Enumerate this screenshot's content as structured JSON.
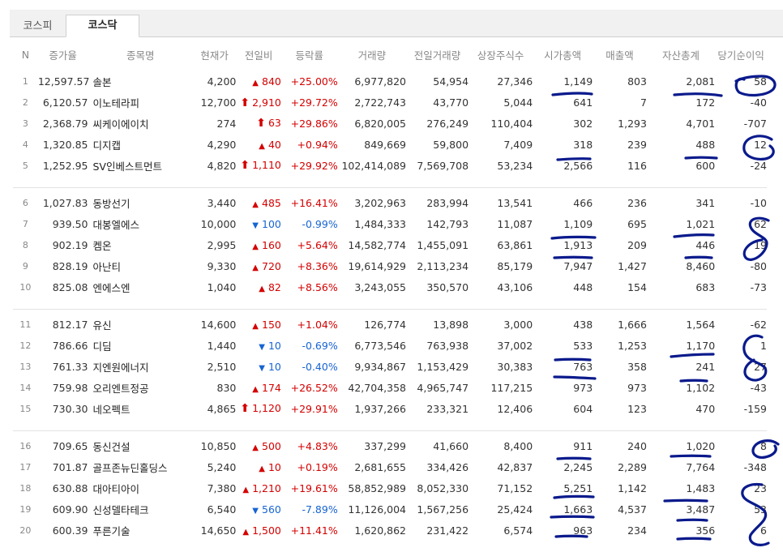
{
  "tabs": [
    {
      "label": "코스피",
      "active": false
    },
    {
      "label": "코스닥",
      "active": true
    }
  ],
  "columns": [
    "N",
    "증가율",
    "종목명",
    "현재가",
    "전일비",
    "등락률",
    "거래량",
    "전일거래량",
    "상장주식수",
    "시가총액",
    "매출액",
    "자산총계",
    "당기순이익"
  ],
  "colors": {
    "up": "#d40000",
    "down": "#1764d3",
    "pen": "#0a1a8c"
  },
  "groups": [
    [
      {
        "n": "1",
        "rate_inc": "12,597.57",
        "name": "솔본",
        "price": "4,200",
        "dir": "up",
        "arrow": "▲",
        "change": "840",
        "pct": "+25.00%",
        "volume": "6,977,820",
        "prev_volume": "54,954",
        "shares": "27,346",
        "mcap": "1,149",
        "sales": "803",
        "assets": "2,081",
        "net_income": "58"
      },
      {
        "n": "2",
        "rate_inc": "6,120.57",
        "name": "이노테라피",
        "price": "12,700",
        "dir": "up",
        "arrow": "⬆",
        "change": "2,910",
        "pct": "+29.72%",
        "volume": "2,722,743",
        "prev_volume": "43,770",
        "shares": "5,044",
        "mcap": "641",
        "sales": "7",
        "assets": "172",
        "net_income": "-40"
      },
      {
        "n": "3",
        "rate_inc": "2,368.79",
        "name": "씨케이에이치",
        "price": "274",
        "dir": "up",
        "arrow": "⬆",
        "change": "63",
        "pct": "+29.86%",
        "volume": "6,820,005",
        "prev_volume": "276,249",
        "shares": "110,404",
        "mcap": "302",
        "sales": "1,293",
        "assets": "4,701",
        "net_income": "-707"
      },
      {
        "n": "4",
        "rate_inc": "1,320.85",
        "name": "디지캡",
        "price": "4,290",
        "dir": "up",
        "arrow": "▲",
        "change": "40",
        "pct": "+0.94%",
        "volume": "849,669",
        "prev_volume": "59,800",
        "shares": "7,409",
        "mcap": "318",
        "sales": "239",
        "assets": "488",
        "net_income": "12"
      },
      {
        "n": "5",
        "rate_inc": "1,252.95",
        "name": "SV인베스트먼트",
        "price": "4,820",
        "dir": "up",
        "arrow": "⬆",
        "change": "1,110",
        "pct": "+29.92%",
        "volume": "102,414,089",
        "prev_volume": "7,569,708",
        "shares": "53,234",
        "mcap": "2,566",
        "sales": "116",
        "assets": "600",
        "net_income": "-24"
      }
    ],
    [
      {
        "n": "6",
        "rate_inc": "1,027.83",
        "name": "동방선기",
        "price": "3,440",
        "dir": "up",
        "arrow": "▲",
        "change": "485",
        "pct": "+16.41%",
        "volume": "3,202,963",
        "prev_volume": "283,994",
        "shares": "13,541",
        "mcap": "466",
        "sales": "236",
        "assets": "341",
        "net_income": "-10"
      },
      {
        "n": "7",
        "rate_inc": "939.50",
        "name": "대봉엘에스",
        "price": "10,000",
        "dir": "down",
        "arrow": "▼",
        "change": "100",
        "pct": "-0.99%",
        "volume": "1,484,333",
        "prev_volume": "142,793",
        "shares": "11,087",
        "mcap": "1,109",
        "sales": "695",
        "assets": "1,021",
        "net_income": "62"
      },
      {
        "n": "8",
        "rate_inc": "902.19",
        "name": "켐온",
        "price": "2,995",
        "dir": "up",
        "arrow": "▲",
        "change": "160",
        "pct": "+5.64%",
        "volume": "14,582,774",
        "prev_volume": "1,455,091",
        "shares": "63,861",
        "mcap": "1,913",
        "sales": "209",
        "assets": "446",
        "net_income": "19"
      },
      {
        "n": "9",
        "rate_inc": "828.19",
        "name": "아난티",
        "price": "9,330",
        "dir": "up",
        "arrow": "▲",
        "change": "720",
        "pct": "+8.36%",
        "volume": "19,614,929",
        "prev_volume": "2,113,234",
        "shares": "85,179",
        "mcap": "7,947",
        "sales": "1,427",
        "assets": "8,460",
        "net_income": "-80"
      },
      {
        "n": "10",
        "rate_inc": "825.08",
        "name": "엔에스엔",
        "price": "1,040",
        "dir": "up",
        "arrow": "▲",
        "change": "82",
        "pct": "+8.56%",
        "volume": "3,243,055",
        "prev_volume": "350,570",
        "shares": "43,106",
        "mcap": "448",
        "sales": "154",
        "assets": "683",
        "net_income": "-73"
      }
    ],
    [
      {
        "n": "11",
        "rate_inc": "812.17",
        "name": "유신",
        "price": "14,600",
        "dir": "up",
        "arrow": "▲",
        "change": "150",
        "pct": "+1.04%",
        "volume": "126,774",
        "prev_volume": "13,898",
        "shares": "3,000",
        "mcap": "438",
        "sales": "1,666",
        "assets": "1,564",
        "net_income": "-62"
      },
      {
        "n": "12",
        "rate_inc": "786.66",
        "name": "디딤",
        "price": "1,440",
        "dir": "down",
        "arrow": "▼",
        "change": "10",
        "pct": "-0.69%",
        "volume": "6,773,546",
        "prev_volume": "763,938",
        "shares": "37,002",
        "mcap": "533",
        "sales": "1,253",
        "assets": "1,170",
        "net_income": "1"
      },
      {
        "n": "13",
        "rate_inc": "761.33",
        "name": "지엔원에너지",
        "price": "2,510",
        "dir": "down",
        "arrow": "▼",
        "change": "10",
        "pct": "-0.40%",
        "volume": "9,934,867",
        "prev_volume": "1,153,429",
        "shares": "30,383",
        "mcap": "763",
        "sales": "358",
        "assets": "241",
        "net_income": "27"
      },
      {
        "n": "14",
        "rate_inc": "759.98",
        "name": "오리엔트정공",
        "price": "830",
        "dir": "up",
        "arrow": "▲",
        "change": "174",
        "pct": "+26.52%",
        "volume": "42,704,358",
        "prev_volume": "4,965,747",
        "shares": "117,215",
        "mcap": "973",
        "sales": "973",
        "assets": "1,102",
        "net_income": "-43"
      },
      {
        "n": "15",
        "rate_inc": "730.30",
        "name": "네오펙트",
        "price": "4,865",
        "dir": "up",
        "arrow": "⬆",
        "change": "1,120",
        "pct": "+29.91%",
        "volume": "1,937,266",
        "prev_volume": "233,321",
        "shares": "12,406",
        "mcap": "604",
        "sales": "123",
        "assets": "470",
        "net_income": "-159"
      }
    ],
    [
      {
        "n": "16",
        "rate_inc": "709.65",
        "name": "동신건설",
        "price": "10,850",
        "dir": "up",
        "arrow": "▲",
        "change": "500",
        "pct": "+4.83%",
        "volume": "337,299",
        "prev_volume": "41,660",
        "shares": "8,400",
        "mcap": "911",
        "sales": "240",
        "assets": "1,020",
        "net_income": "8"
      },
      {
        "n": "17",
        "rate_inc": "701.87",
        "name": "골프존뉴딘홀딩스",
        "price": "5,240",
        "dir": "up",
        "arrow": "▲",
        "change": "10",
        "pct": "+0.19%",
        "volume": "2,681,655",
        "prev_volume": "334,426",
        "shares": "42,837",
        "mcap": "2,245",
        "sales": "2,289",
        "assets": "7,764",
        "net_income": "-348"
      },
      {
        "n": "18",
        "rate_inc": "630.88",
        "name": "대아티아이",
        "price": "7,380",
        "dir": "up",
        "arrow": "▲",
        "change": "1,210",
        "pct": "+19.61%",
        "volume": "58,852,989",
        "prev_volume": "8,052,330",
        "shares": "71,152",
        "mcap": "5,251",
        "sales": "1,142",
        "assets": "1,483",
        "net_income": "23"
      },
      {
        "n": "19",
        "rate_inc": "609.90",
        "name": "신성델타테크",
        "price": "6,540",
        "dir": "down",
        "arrow": "▼",
        "change": "560",
        "pct": "-7.89%",
        "volume": "11,126,004",
        "prev_volume": "1,567,256",
        "shares": "25,424",
        "mcap": "1,663",
        "sales": "4,537",
        "assets": "3,487",
        "net_income": "53"
      },
      {
        "n": "20",
        "rate_inc": "600.39",
        "name": "푸른기술",
        "price": "14,650",
        "dir": "up",
        "arrow": "▲",
        "change": "1,500",
        "pct": "+11.41%",
        "volume": "1,620,862",
        "prev_volume": "231,422",
        "shares": "6,574",
        "mcap": "963",
        "sales": "234",
        "assets": "356",
        "net_income": "6"
      }
    ]
  ]
}
